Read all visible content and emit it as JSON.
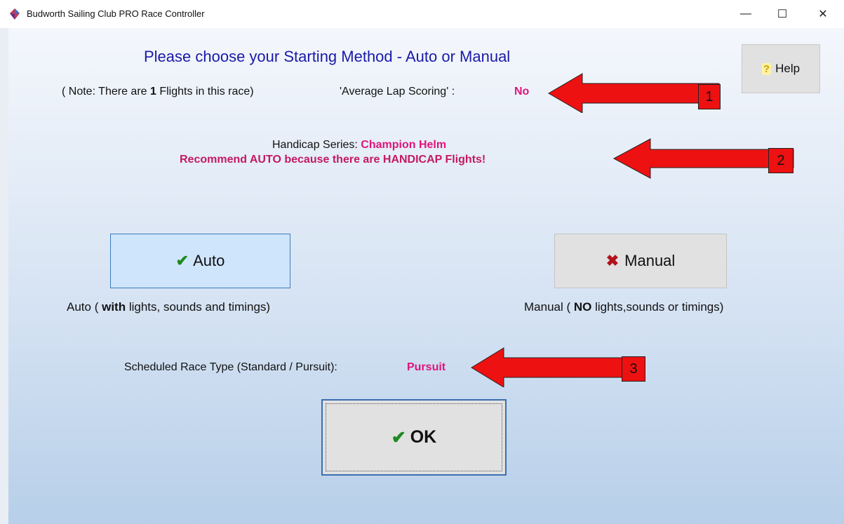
{
  "window": {
    "title": "Budworth Sailing Club PRO Race Controller",
    "controls": {
      "minimize": "—",
      "maximize": "☐",
      "close": "✕"
    }
  },
  "dialog": {
    "heading": "Please choose your Starting Method - Auto or Manual",
    "note_prefix": "( Note: There  are ",
    "flights_count": "1",
    "note_suffix": " Flights in this race)",
    "lap_scoring_label": "'Average Lap Scoring' :",
    "lap_scoring_value": "No",
    "help_label": "Help",
    "handicap_label": "Handicap Series:",
    "handicap_value": "Champion Helm",
    "recommendation": "Recommend AUTO because there are HANDICAP Flights!",
    "auto_label": "Auto",
    "manual_label": "Manual",
    "auto_desc_prefix": "Auto ( ",
    "auto_desc_bold": "with",
    "auto_desc_suffix": " lights, sounds and timings)",
    "manual_desc_prefix": "Manual ( ",
    "manual_desc_bold": "NO",
    "manual_desc_suffix": " lights,sounds or timings)",
    "race_type_label": "Scheduled Race Type (Standard / Pursuit):",
    "race_type_value": "Pursuit",
    "ok_label": "OK"
  },
  "annotations": [
    {
      "number": "1"
    },
    {
      "number": "2"
    },
    {
      "number": "3"
    }
  ],
  "colors": {
    "heading": "#1a1aa8",
    "highlight": "#e0147c",
    "recommendation": "#c31a63",
    "arrow": "#ee1111"
  }
}
